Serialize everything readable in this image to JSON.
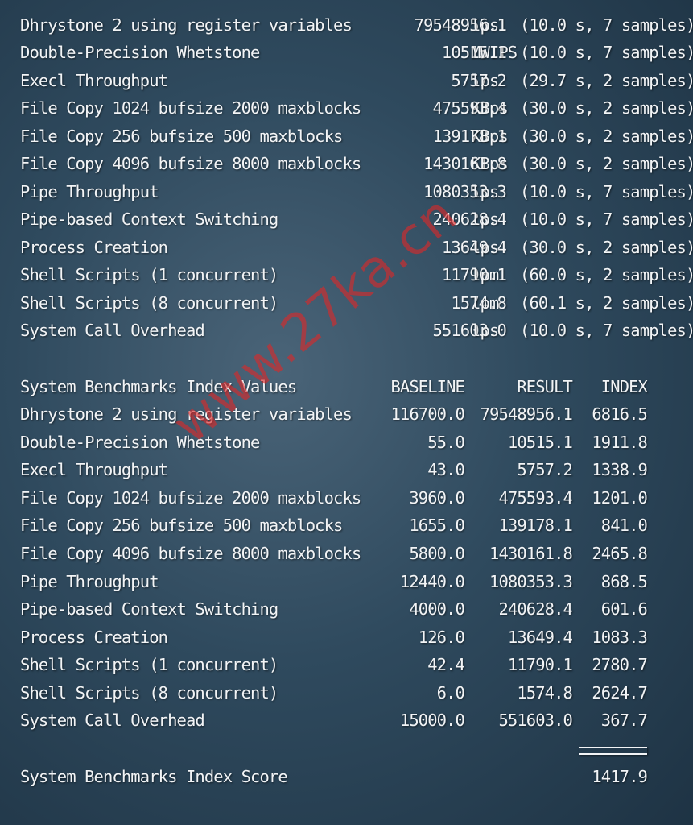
{
  "results": [
    {
      "name": "Dhrystone 2 using register variables",
      "value": "79548956.1",
      "unit": "lps",
      "detail": "(10.0 s, 7 samples)"
    },
    {
      "name": "Double-Precision Whetstone",
      "value": "10515.1",
      "unit": "MWIPS",
      "detail": "(10.0 s, 7 samples)"
    },
    {
      "name": "Execl Throughput",
      "value": "5757.2",
      "unit": "lps",
      "detail": "(29.7 s, 2 samples)"
    },
    {
      "name": "File Copy 1024 bufsize 2000 maxblocks",
      "value": "475593.4",
      "unit": "KBps",
      "detail": "(30.0 s, 2 samples)"
    },
    {
      "name": "File Copy 256 bufsize 500 maxblocks",
      "value": "139178.1",
      "unit": "KBps",
      "detail": "(30.0 s, 2 samples)"
    },
    {
      "name": "File Copy 4096 bufsize 8000 maxblocks",
      "value": "1430161.8",
      "unit": "KBps",
      "detail": "(30.0 s, 2 samples)"
    },
    {
      "name": "Pipe Throughput",
      "value": "1080353.3",
      "unit": "lps",
      "detail": "(10.0 s, 7 samples)"
    },
    {
      "name": "Pipe-based Context Switching",
      "value": "240628.4",
      "unit": "lps",
      "detail": "(10.0 s, 7 samples)"
    },
    {
      "name": "Process Creation",
      "value": "13649.4",
      "unit": "lps",
      "detail": "(30.0 s, 2 samples)"
    },
    {
      "name": "Shell Scripts (1 concurrent)",
      "value": "11790.1",
      "unit": "lpm",
      "detail": "(60.0 s, 2 samples)"
    },
    {
      "name": "Shell Scripts (8 concurrent)",
      "value": "1574.8",
      "unit": "lpm",
      "detail": "(60.1 s, 2 samples)"
    },
    {
      "name": "System Call Overhead",
      "value": "551603.0",
      "unit": "lps",
      "detail": "(10.0 s, 7 samples)"
    }
  ],
  "index": {
    "title": "System Benchmarks Index Values",
    "headers": {
      "baseline": "BASELINE",
      "result": "RESULT",
      "index": "INDEX"
    },
    "rows": [
      {
        "name": "Dhrystone 2 using register variables",
        "baseline": "116700.0",
        "result": "79548956.1",
        "index": "6816.5"
      },
      {
        "name": "Double-Precision Whetstone",
        "baseline": "55.0",
        "result": "10515.1",
        "index": "1911.8"
      },
      {
        "name": "Execl Throughput",
        "baseline": "43.0",
        "result": "5757.2",
        "index": "1338.9"
      },
      {
        "name": "File Copy 1024 bufsize 2000 maxblocks",
        "baseline": "3960.0",
        "result": "475593.4",
        "index": "1201.0"
      },
      {
        "name": "File Copy 256 bufsize 500 maxblocks",
        "baseline": "1655.0",
        "result": "139178.1",
        "index": "841.0"
      },
      {
        "name": "File Copy 4096 bufsize 8000 maxblocks",
        "baseline": "5800.0",
        "result": "1430161.8",
        "index": "2465.8"
      },
      {
        "name": "Pipe Throughput",
        "baseline": "12440.0",
        "result": "1080353.3",
        "index": "868.5"
      },
      {
        "name": "Pipe-based Context Switching",
        "baseline": "4000.0",
        "result": "240628.4",
        "index": "601.6"
      },
      {
        "name": "Process Creation",
        "baseline": "126.0",
        "result": "13649.4",
        "index": "1083.3"
      },
      {
        "name": "Shell Scripts (1 concurrent)",
        "baseline": "42.4",
        "result": "11790.1",
        "index": "2780.7"
      },
      {
        "name": "Shell Scripts (8 concurrent)",
        "baseline": "6.0",
        "result": "1574.8",
        "index": "2624.7"
      },
      {
        "name": "System Call Overhead",
        "baseline": "15000.0",
        "result": "551603.0",
        "index": "367.7"
      }
    ],
    "score_label": "System Benchmarks Index Score",
    "score": "1417.9"
  },
  "watermark": "www.27ka.cn",
  "colors": {
    "text": "#f2f4f6",
    "watermark": "#dc2828",
    "background": "#2f4a5e"
  }
}
